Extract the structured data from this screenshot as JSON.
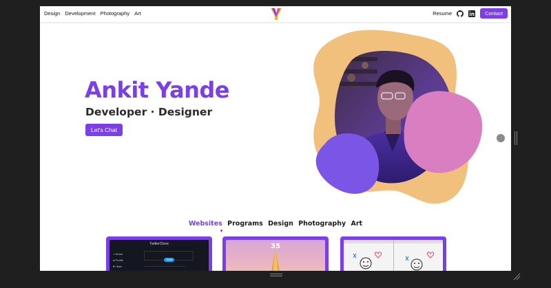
{
  "nav": {
    "links": [
      "Design",
      "Development",
      "Photography",
      "Art"
    ],
    "resume_label": "Resume",
    "contact_label": "Contact",
    "icons": [
      "github-icon",
      "linkedin-icon"
    ]
  },
  "hero": {
    "name": "Ankit Yande",
    "subtitle": "Developer · Designer",
    "cta_label": "Let's Chat"
  },
  "portfolio": {
    "tabs": [
      "Websites",
      "Programs",
      "Design",
      "Photography",
      "Art"
    ],
    "active_tab": "Websites",
    "cards": [
      {
        "title": "TwitterClone",
        "menu": [
          "Home",
          "Profile",
          "Likes"
        ],
        "button": "Tweet"
      },
      {
        "number": "35"
      },
      {
        "description": "sketch-ui"
      }
    ]
  },
  "colors": {
    "accent": "#7b3fe4",
    "blob_orange": "#f0c07c",
    "blob_pink": "#d97ec0",
    "blob_purple": "#7a55e6"
  }
}
